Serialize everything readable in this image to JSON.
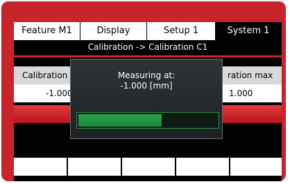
{
  "tabs": [
    {
      "label": "Feature  M1",
      "active": false
    },
    {
      "label": "Display",
      "active": false
    },
    {
      "label": "Setup 1",
      "active": false
    },
    {
      "label": "System 1",
      "active": true
    }
  ],
  "breadcrumb": "Calibration -> Calibration C1",
  "table": {
    "headers": [
      "Calibration",
      "ration max"
    ],
    "row": [
      "-1.000",
      "1.000"
    ]
  },
  "dialog": {
    "title": "Measuring at:",
    "value": "-1.000 [mm]",
    "progress_fraction": 0.6
  },
  "softkeys": [
    "",
    "",
    "",
    "",
    ""
  ],
  "colors": {
    "frame": "#c8242b",
    "screen": "#000000",
    "progress": "#1f9a45",
    "header_row": "#d9d9d9"
  }
}
